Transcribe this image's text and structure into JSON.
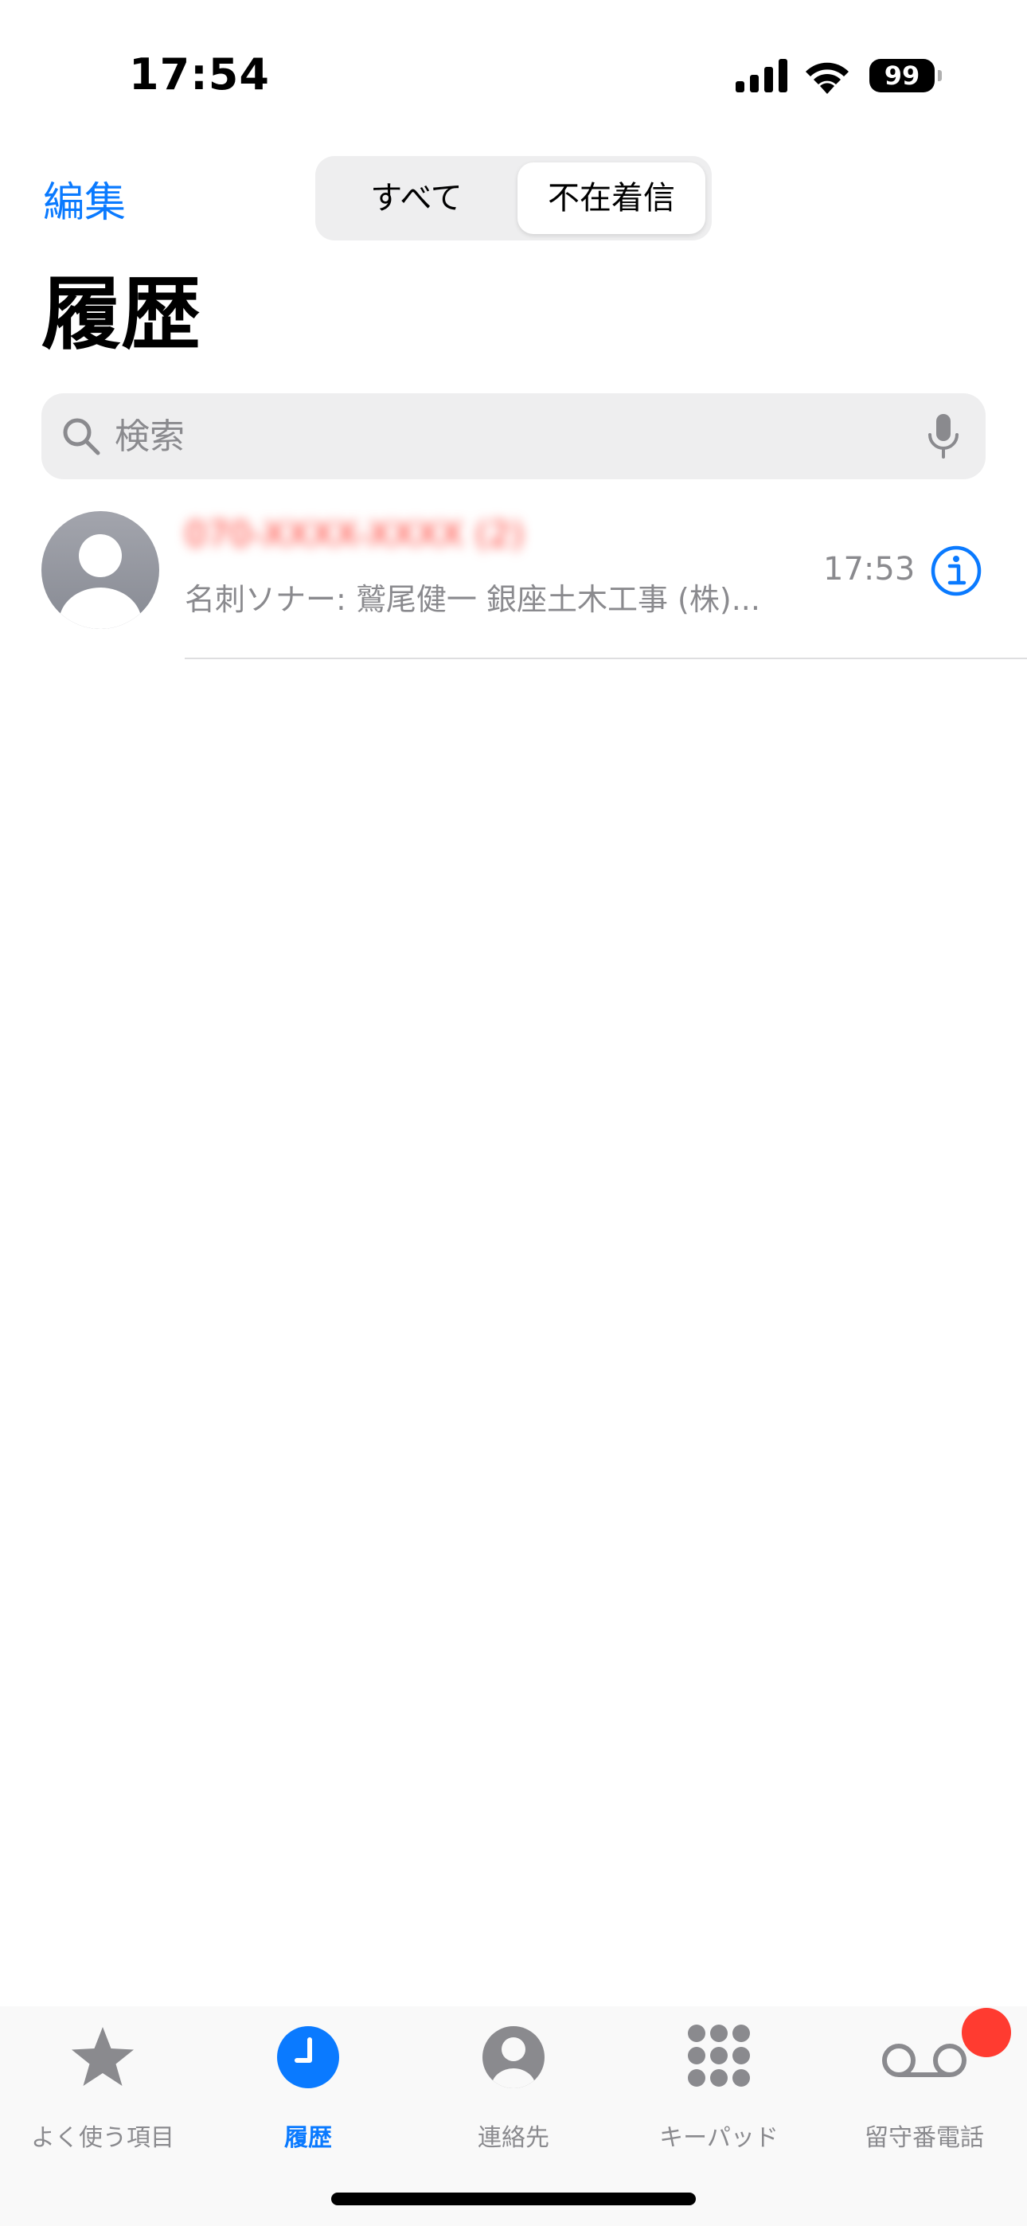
{
  "status_bar": {
    "time": "17:54",
    "battery": "99"
  },
  "header": {
    "edit_label": "編集",
    "segments": [
      "すべて",
      "不在着信"
    ],
    "selected_segment": "不在着信",
    "title": "履歴"
  },
  "search": {
    "placeholder": "検索",
    "value": ""
  },
  "calls": [
    {
      "name": "070-XXXX-XXXX (2)",
      "subtitle": "名刺ソナー: 鷲尾健一 銀座土木工事 (株)...",
      "time": "17:53",
      "missed": true
    }
  ],
  "tabs": [
    {
      "label": "よく使う項目",
      "icon": "star-icon",
      "active": false
    },
    {
      "label": "履歴",
      "icon": "clock-icon",
      "active": true
    },
    {
      "label": "連絡先",
      "icon": "person-circle-icon",
      "active": false
    },
    {
      "label": "キーパッド",
      "icon": "keypad-icon",
      "active": false
    },
    {
      "label": "留守番電話",
      "icon": "voicemail-icon",
      "active": false,
      "badge": true
    }
  ],
  "colors": {
    "accent": "#0a7aff",
    "missed": "#ff3b30",
    "secondary_text": "#8a8a8e",
    "badge": "#ff3b30"
  }
}
